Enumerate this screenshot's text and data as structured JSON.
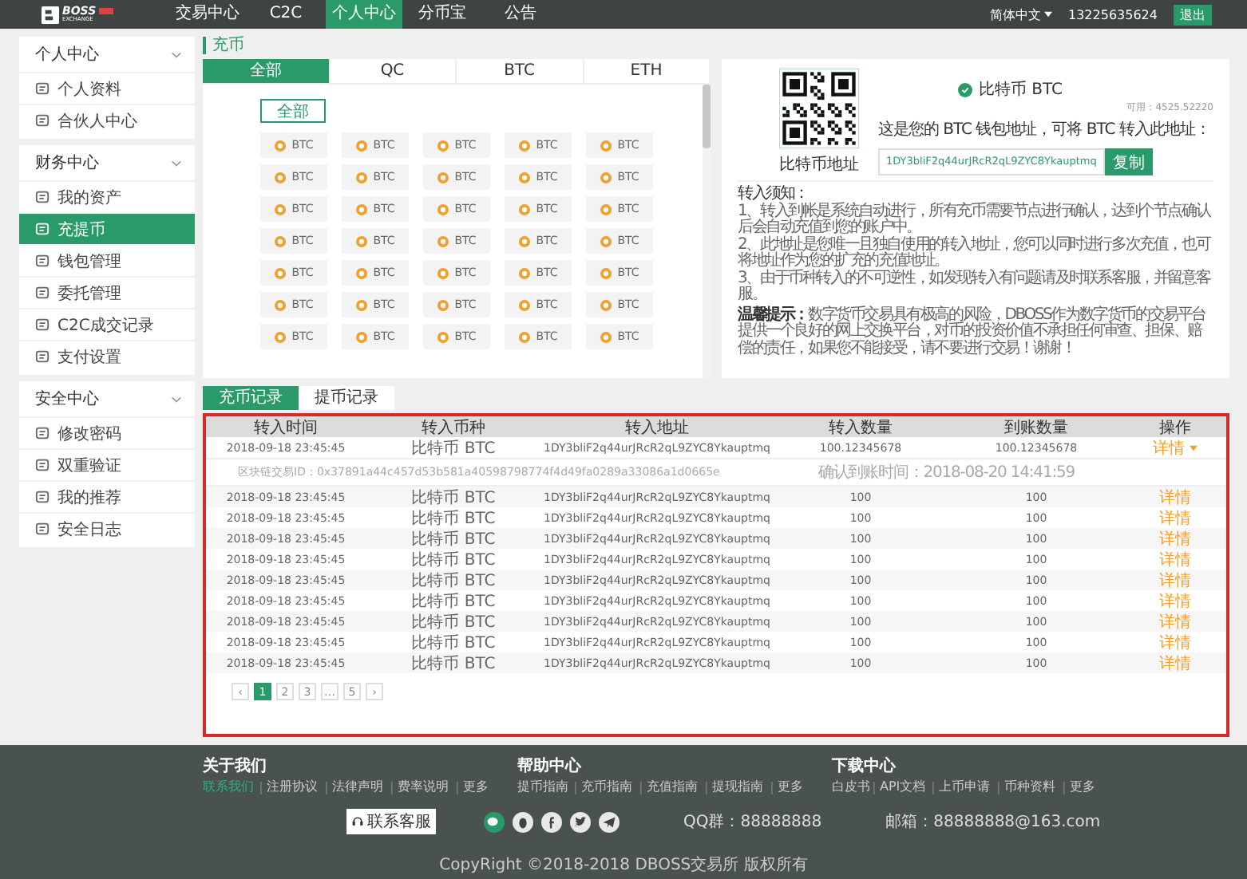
{
  "nav": {
    "logo": {
      "name": "BOSS",
      "sub": "EXCHANGE"
    },
    "items": [
      {
        "label": "交易中心",
        "selected": false
      },
      {
        "label": "C2C",
        "selected": false
      },
      {
        "label": "个人中心",
        "selected": true
      },
      {
        "label": "分币宝",
        "selected": false
      },
      {
        "label": "公告",
        "selected": false
      }
    ],
    "language": "简体中文",
    "phone": "13225635624",
    "logout": "退出"
  },
  "sidebar": [
    {
      "title": "个人中心",
      "items": [
        {
          "label": "个人资料",
          "selected": false
        },
        {
          "label": "合伙人中心",
          "selected": false
        }
      ]
    },
    {
      "title": "财务中心",
      "items": [
        {
          "label": "我的资产",
          "selected": false
        },
        {
          "label": "充提币",
          "selected": true
        },
        {
          "label": "钱包管理",
          "selected": false
        },
        {
          "label": "委托管理",
          "selected": false
        },
        {
          "label": "C2C成交记录",
          "selected": false
        },
        {
          "label": "支付设置",
          "selected": false
        }
      ]
    },
    {
      "title": "安全中心",
      "items": [
        {
          "label": "修改密码",
          "selected": false
        },
        {
          "label": "双重验证",
          "selected": false
        },
        {
          "label": "我的推荐",
          "selected": false
        },
        {
          "label": "安全日志",
          "selected": false
        }
      ]
    }
  ],
  "breadcrumb": "充币",
  "coin_tabs": [
    {
      "label": "全部",
      "selected": true
    },
    {
      "label": "QC",
      "selected": false
    },
    {
      "label": "BTC",
      "selected": false
    },
    {
      "label": "ETH",
      "selected": false
    }
  ],
  "all_button": "全部",
  "coins": [
    "BTC",
    "BTC",
    "BTC",
    "BTC",
    "BTC",
    "BTC",
    "BTC",
    "BTC",
    "BTC",
    "BTC",
    "BTC",
    "BTC",
    "BTC",
    "BTC",
    "BTC",
    "BTC",
    "BTC",
    "BTC",
    "BTC",
    "BTC",
    "BTC",
    "BTC",
    "BTC",
    "BTC",
    "BTC",
    "BTC",
    "BTC",
    "BTC",
    "BTC",
    "BTC",
    "BTC",
    "BTC",
    "BTC",
    "BTC",
    "BTC"
  ],
  "deposit": {
    "qr_caption": "比特币地址",
    "coin": "比特币 BTC",
    "available": "可用：4525.52220",
    "hint": "这是您的 BTC 钱包地址，可将 BTC 转入此地址：",
    "address": "1DY3bliF2q44urJRcR2qL9ZYC8Ykauptmq",
    "copy": "复制",
    "notes_title": "转入须知：",
    "notes": [
      "1、转入到帐是系统自动进行，所有充币需要节点进行确认，达到个节点确认后会自动充值到您的账户中。",
      "2、此地址是您唯一且独自使用的转入地址，您可以同时进行多次充值，也可将地址作为您的扩充的充值地址。",
      "3、由于币种转入的不可逆性，如发现转入有问题请及时联系客服，并留意客服。"
    ],
    "warning": "**温馨提示：**数字货币交易具有极高的风险，DBOSS作为数字货币的交易平台提供一个良好的网上交换平台，对币的投资价值不承担任何审查、担保、赔偿的责任，如果您不能接受，请不要进行交易！谢谢！"
  },
  "record_tabs": [
    {
      "label": "充币记录",
      "selected": true
    },
    {
      "label": "提币记录",
      "selected": false
    }
  ],
  "table": {
    "columns": [
      "转入时间",
      "转入币种",
      "转入地址",
      "转入数量",
      "到账数量",
      "操作"
    ],
    "rows": [
      {
        "time": "2018-09-18 23:45:45",
        "coin": "比特币 BTC",
        "address": "1DY3bliF2q44urJRcR2qL9ZYC8Ykauptmq",
        "amount": "100.12345678",
        "received": "100.12345678",
        "action": "详情",
        "expanded": true,
        "txid": "区块链交易ID：0x37891a44c457d53b581a40598798774f4d49fa0289a33086a1d0665e",
        "confirmed": "确认到账时间：2018-08-20 14:41:59"
      },
      {
        "time": "2018-09-18 23:45:45",
        "coin": "比特币 BTC",
        "address": "1DY3bliF2q44urJRcR2qL9ZYC8Ykauptmq",
        "amount": "100",
        "received": "100",
        "action": "详情",
        "expanded": false
      },
      {
        "time": "2018-09-18 23:45:45",
        "coin": "比特币 BTC",
        "address": "1DY3bliF2q44urJRcR2qL9ZYC8Ykauptmq",
        "amount": "100",
        "received": "100",
        "action": "详情",
        "expanded": false
      },
      {
        "time": "2018-09-18 23:45:45",
        "coin": "比特币 BTC",
        "address": "1DY3bliF2q44urJRcR2qL9ZYC8Ykauptmq",
        "amount": "100",
        "received": "100",
        "action": "详情",
        "expanded": false
      },
      {
        "time": "2018-09-18 23:45:45",
        "coin": "比特币 BTC",
        "address": "1DY3bliF2q44urJRcR2qL9ZYC8Ykauptmq",
        "amount": "100",
        "received": "100",
        "action": "详情",
        "expanded": false
      },
      {
        "time": "2018-09-18 23:45:45",
        "coin": "比特币 BTC",
        "address": "1DY3bliF2q44urJRcR2qL9ZYC8Ykauptmq",
        "amount": "100",
        "received": "100",
        "action": "详情",
        "expanded": false
      },
      {
        "time": "2018-09-18 23:45:45",
        "coin": "比特币 BTC",
        "address": "1DY3bliF2q44urJRcR2qL9ZYC8Ykauptmq",
        "amount": "100",
        "received": "100",
        "action": "详情",
        "expanded": false
      },
      {
        "time": "2018-09-18 23:45:45",
        "coin": "比特币 BTC",
        "address": "1DY3bliF2q44urJRcR2qL9ZYC8Ykauptmq",
        "amount": "100",
        "received": "100",
        "action": "详情",
        "expanded": false
      },
      {
        "time": "2018-09-18 23:45:45",
        "coin": "比特币 BTC",
        "address": "1DY3bliF2q44urJRcR2qL9ZYC8Ykauptmq",
        "amount": "100",
        "received": "100",
        "action": "详情",
        "expanded": false
      },
      {
        "time": "2018-09-18 23:45:45",
        "coin": "比特币 BTC",
        "address": "1DY3bliF2q44urJRcR2qL9ZYC8Ykauptmq",
        "amount": "100",
        "received": "100",
        "action": "详情",
        "expanded": false
      }
    ]
  },
  "pagination": {
    "prev": "‹",
    "pages": [
      {
        "label": "1",
        "selected": true
      },
      {
        "label": "2",
        "selected": false
      },
      {
        "label": "3",
        "selected": false
      },
      {
        "label": "…",
        "selected": false
      },
      {
        "label": "5",
        "selected": false
      }
    ],
    "next": "›"
  },
  "footer": {
    "columns": [
      {
        "title": "关于我们",
        "links": [
          {
            "label": "联系我们",
            "selected": true
          },
          {
            "label": "注册协议",
            "selected": false
          },
          {
            "label": "法律声明",
            "selected": false
          },
          {
            "label": "费率说明",
            "selected": false
          },
          {
            "label": "更多",
            "selected": false
          }
        ]
      },
      {
        "title": "帮助中心",
        "links": [
          {
            "label": "提币指南",
            "selected": false
          },
          {
            "label": "充币指南",
            "selected": false
          },
          {
            "label": "充值指南",
            "selected": false
          },
          {
            "label": "提现指南",
            "selected": false
          },
          {
            "label": "更多",
            "selected": false
          }
        ]
      },
      {
        "title": "下载中心",
        "links": [
          {
            "label": "白皮书",
            "selected": false
          },
          {
            "label": "API文档",
            "selected": false
          },
          {
            "label": "上币申请",
            "selected": false
          },
          {
            "label": "币种资料",
            "selected": false
          },
          {
            "label": "更多",
            "selected": false
          }
        ]
      }
    ],
    "service": "联系客服",
    "qq": "QQ群：88888888",
    "email": "邮箱：88888888@163.com",
    "copyright": "CopyRight ©2018-2018 DBOSS交易所 版权所有"
  }
}
